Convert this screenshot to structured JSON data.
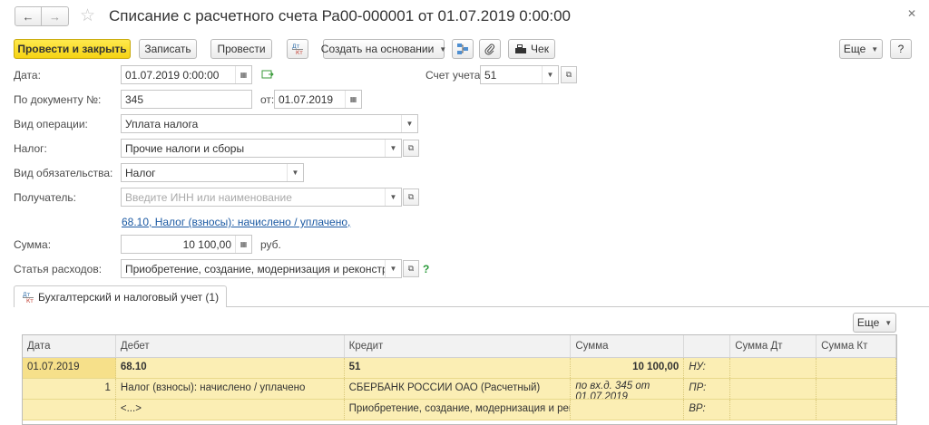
{
  "window": {
    "title": "Списание с расчетного счета Ра00-000001 от 01.07.2019 0:00:00",
    "back_icon": "arrow-left-icon",
    "forward_icon": "arrow-right-icon",
    "favorite_icon": "star-icon",
    "close_glyph": "✕"
  },
  "toolbar": {
    "post_close": "Провести и закрыть",
    "save": "Записать",
    "post": "Провести",
    "dtkt": "ДтКт",
    "create_based": "Создать на основании",
    "check": "Чек",
    "more": "Еще",
    "help": "?"
  },
  "form": {
    "date_label": "Дата:",
    "date_value": "01.07.2019  0:00:00",
    "account_label": "Счет учета:",
    "account_value": "51",
    "doc_label": "По документу №:",
    "doc_value": "345",
    "from_label": "от:",
    "from_value": "01.07.2019",
    "operation_label": "Вид операции:",
    "operation_value": "Уплата налога",
    "tax_label": "Налог:",
    "tax_value": "Прочие налоги и сборы",
    "liability_label": "Вид обязательства:",
    "liability_value": "Налог",
    "recipient_label": "Получатель:",
    "recipient_placeholder": "Введите ИНН или наименование",
    "account_link": "68.10, Налог (взносы): начислено / уплачено,",
    "sum_label": "Сумма:",
    "sum_value": "10 100,00",
    "currency": "руб.",
    "expense_label": "Статья расходов:",
    "expense_value": "Приобретение, создание, модернизация и реконструкция вн",
    "help_mark": "?"
  },
  "tab": {
    "label": "Бухгалтерский и налоговый учет (1)"
  },
  "grid": {
    "more": "Еще",
    "headers": [
      "Дата",
      "Дебет",
      "Кредит",
      "Сумма",
      "",
      "Сумма Дт",
      "Сумма Кт"
    ],
    "row": {
      "date": "01.07.2019",
      "num": "1",
      "debit": "68.10",
      "debit_sub1": "Налог (взносы): начислено / уплачено",
      "debit_sub2": "<...>",
      "credit": "51",
      "credit_sub1": "СБЕРБАНК РОССИИ ОАО (Расчетный)",
      "credit_sub2": "Приобретение, создание, модернизация и рек...",
      "sum": "10 100,00",
      "sum_note": "по вх.д. 345 от 01.07.2019",
      "nu": "НУ:",
      "pr": "ПР:",
      "vr": "ВР:"
    }
  }
}
